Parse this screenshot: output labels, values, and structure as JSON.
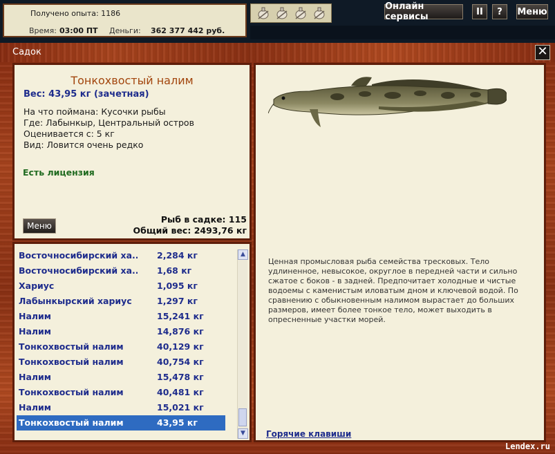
{
  "stats": {
    "experience": "Получено опыта: 1186",
    "time_label": "Время:",
    "time_value": "03:00 ПТ",
    "money_label": "Деньги:",
    "money_value": "362 377 442 руб."
  },
  "top_buttons": {
    "online": "Онлайн сервисы",
    "pause": "II",
    "help": "?",
    "menu": "Меню"
  },
  "trophy_icons": [
    "trophy-icon",
    "trophy-icon",
    "trophy-icon",
    "trophy-icon"
  ],
  "window": {
    "title": "Садок",
    "close": "✕"
  },
  "fish": {
    "name": "Тонкохвостый налим",
    "weight": "Вес: 43,95 кг (зачетная)",
    "bait": "На что поймана: Кусочки рыбы",
    "where": "Где: Лабынкыр, Центральный остров",
    "rated": "Оценивается с: 5 кг",
    "kind": "Вид: Ловится очень редко",
    "license": "Есть лицензия",
    "menu_button": "Меню",
    "keep_count": "Рыб в садке: 115",
    "total_weight": "Общий вес: 2493,76 кг",
    "description": "Ценная промысловая рыба семейства тресковых. Тело удлиненное, невысокое, округлое в передней части и сильно сжатое с боков - в задней. Предпочитает холодные и чистые водоемы с каменистым иловатым дном и ключевой водой. По сравнению с обыкновенным налимом вырастает до больших размеров, имеет более тонкое тело, может выходить в опресненные участки морей."
  },
  "catch_list": [
    {
      "name": "Восточносибирский ха...",
      "weight": "2,284 кг"
    },
    {
      "name": "Восточносибирский ха...",
      "weight": "1,68 кг"
    },
    {
      "name": "Хариус",
      "weight": "1,095 кг"
    },
    {
      "name": "Лабынкырский хариус",
      "weight": "1,297 кг"
    },
    {
      "name": "Налим",
      "weight": "15,241 кг"
    },
    {
      "name": "Налим",
      "weight": "14,876 кг"
    },
    {
      "name": "Тонкохвостый налим",
      "weight": "40,129 кг"
    },
    {
      "name": "Тонкохвостый налим",
      "weight": "40,754 кг"
    },
    {
      "name": "Налим",
      "weight": "15,478 кг"
    },
    {
      "name": "Тонкохвостый налим",
      "weight": "40,481 кг"
    },
    {
      "name": "Налим",
      "weight": "15,021 кг"
    },
    {
      "name": "Тонкохвостый налим",
      "weight": "43,95 кг",
      "selected": true
    }
  ],
  "hotkeys": "Горячие клавиши",
  "watermark": "Lendex.ru",
  "colors": {
    "wood": "#8c3114",
    "panel": "#f4f0dc",
    "fish_title": "#a2450d",
    "list_text": "#1e2c8c",
    "selection": "#2e6bc1",
    "license": "#1f6a1f"
  }
}
